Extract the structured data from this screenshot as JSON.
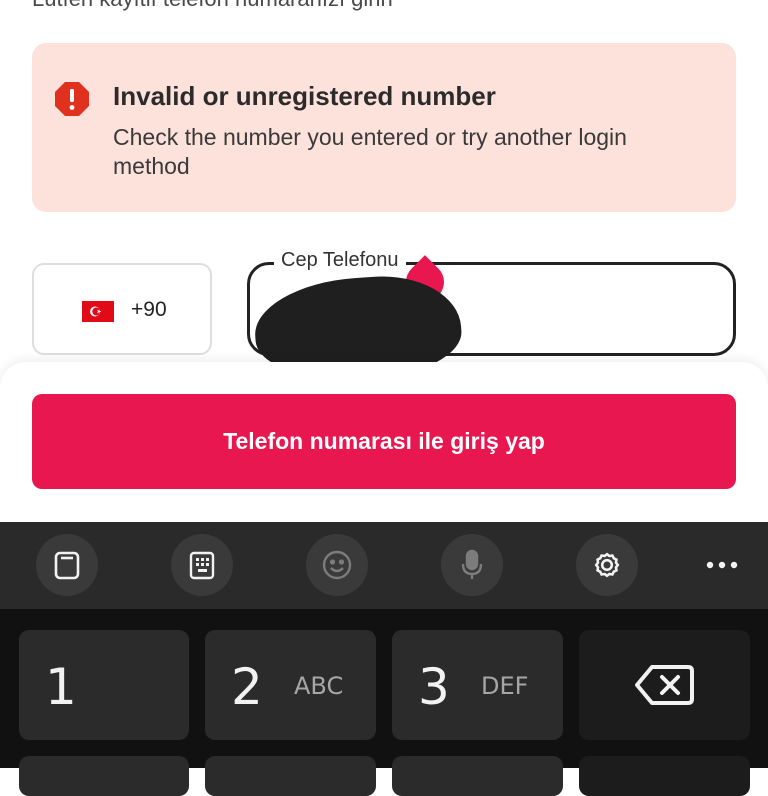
{
  "header": {
    "instruction": "Lütfen kayıtlı telefon numaranızı girin"
  },
  "error": {
    "title": "Invalid or unregistered number",
    "message": "Check the number you entered or try another login method",
    "color": "#e0301e",
    "background": "#fde2dc"
  },
  "phone": {
    "country_code": "+90",
    "label": "Cep Telefonu"
  },
  "login": {
    "button_label": "Telefon numarası ile giriş yap",
    "color": "#e8174f"
  },
  "keyboard": {
    "toolbar": [
      "clipboard-icon",
      "keypad-icon",
      "emoji-icon",
      "microphone-icon",
      "settings-icon",
      "more-icon"
    ],
    "keys": [
      {
        "digit": "1",
        "letters": ""
      },
      {
        "digit": "2",
        "letters": "ABC"
      },
      {
        "digit": "3",
        "letters": "DEF"
      }
    ]
  }
}
